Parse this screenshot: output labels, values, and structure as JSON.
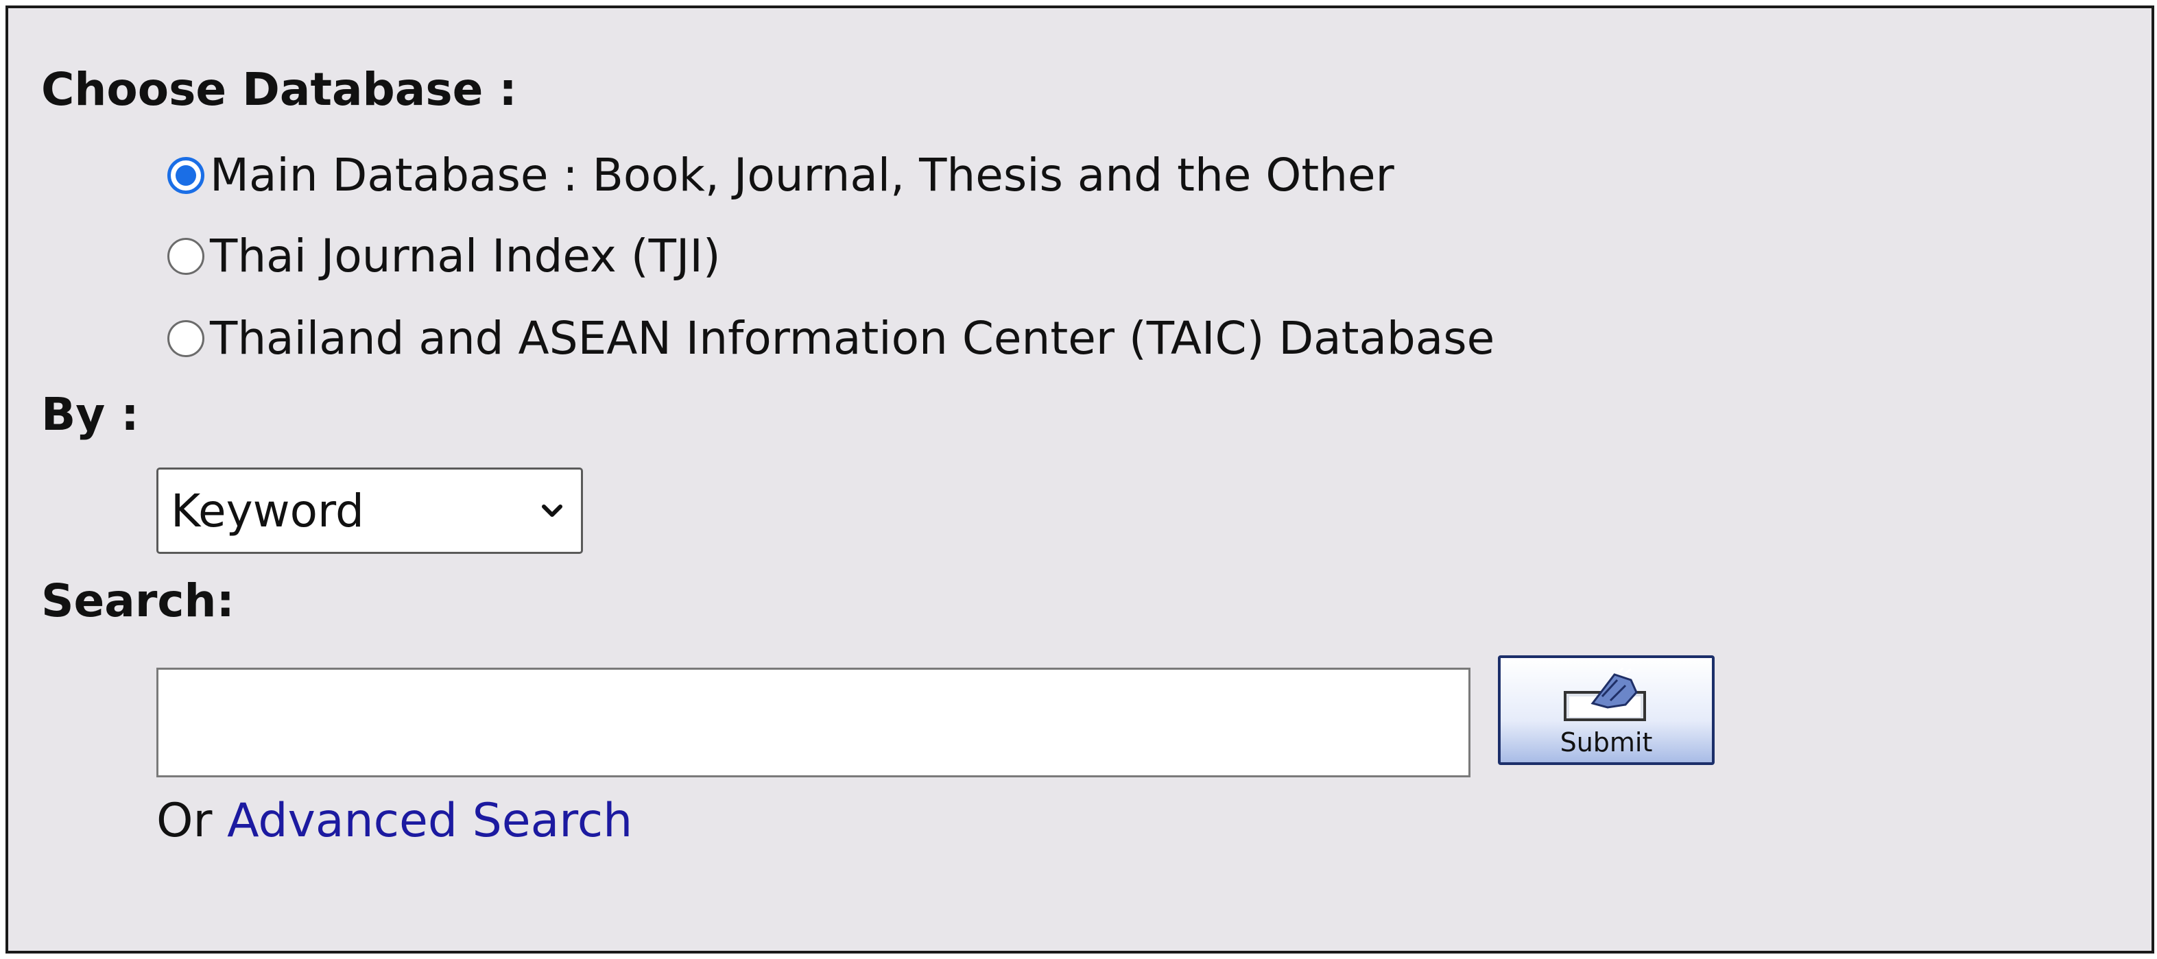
{
  "labels": {
    "choose_database": "Choose Database :",
    "by": "By :",
    "search": "Search:"
  },
  "database_options": [
    {
      "label": "Main Database : Book, Journal, Thesis and the Other",
      "checked": true
    },
    {
      "label": "Thai Journal Index (TJI)",
      "checked": false
    },
    {
      "label": "Thailand and ASEAN Information Center (TAIC) Database",
      "checked": false
    }
  ],
  "by_select": {
    "selected": "Keyword"
  },
  "search": {
    "value": "",
    "placeholder": ""
  },
  "submit_button": {
    "label": "Submit",
    "icon": "submit-hand-icon"
  },
  "advanced": {
    "prefix": "Or ",
    "link_label": "Advanced Search"
  },
  "colors": {
    "panel_background": "#e8e6ea",
    "radio_checked": "#1a6ee6",
    "link": "#1c1aa0",
    "button_border": "#1c2f6a"
  }
}
